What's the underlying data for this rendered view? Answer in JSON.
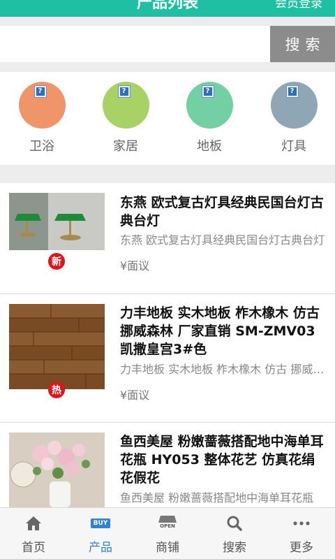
{
  "header": {
    "title": "产品列表",
    "login": "会员登录",
    "color": "#1fbfa3"
  },
  "search": {
    "value": "",
    "placeholder": "",
    "button": "搜索"
  },
  "categories": [
    {
      "label": "卫浴",
      "color": "#f0956a"
    },
    {
      "label": "家居",
      "color": "#a9d266"
    },
    {
      "label": "地板",
      "color": "#73d0a4"
    },
    {
      "label": "灯具",
      "color": "#8ea6b6"
    }
  ],
  "products": [
    {
      "name": "东燕 欧式复古灯具经典民国台灯古典台灯",
      "desc": "东燕 欧式复古灯具经典民国台灯古典台灯",
      "price": "¥面议",
      "badge": "新"
    },
    {
      "name": "力丰地板 实木地板 柞木橡木 仿古 挪威森林 厂家直销 SM-ZMV03 凯撒皇宫3#色",
      "desc": "力丰地板 实木地板 柞木橡木 仿古 挪威森林 厂家直销",
      "price": "¥面议",
      "badge": "热"
    },
    {
      "name": "鱼西美屋 粉嫩蔷薇搭配地中海单耳花瓶 HY053 整体花艺 仿真花绢花假花",
      "desc": "鱼西美屋 粉嫩蔷薇搭配地中海单耳花瓶",
      "price": "",
      "badge": ""
    }
  ],
  "tabbar": [
    {
      "label": "首页",
      "icon": "home-icon"
    },
    {
      "label": "产品",
      "icon": "buy-icon",
      "icon_text": "BUY",
      "active": true
    },
    {
      "label": "商铺",
      "icon": "shop-icon",
      "icon_text": "OPEN"
    },
    {
      "label": "搜索",
      "icon": "search-icon"
    },
    {
      "label": "更多",
      "icon": "more-icon"
    }
  ]
}
